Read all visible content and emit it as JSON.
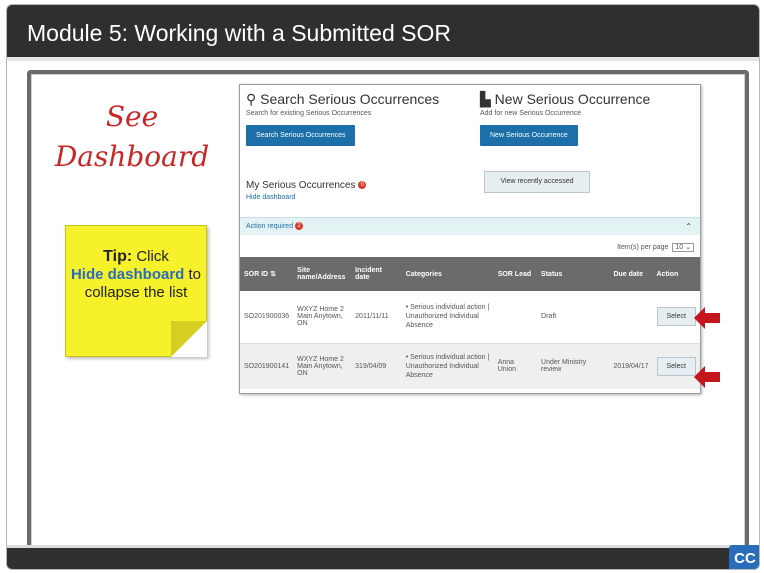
{
  "module_title": "Module 5:  Working with a Submitted SOR",
  "see_dashboard": {
    "line1": "See",
    "line2": "Dashboard"
  },
  "tip": {
    "label": "Tip:",
    "text1": "Click",
    "link": "Hide dashboard",
    "text2": "to collapse the list"
  },
  "panel": {
    "search": {
      "title": "Search Serious Occurrences",
      "subtitle": "Search for existing Serious Occurrences",
      "button": "Search Serious Occurrences",
      "icon": "search-icon"
    },
    "new": {
      "title": "New Serious Occurrence",
      "subtitle": "Add for new Serious Occurrence",
      "button": "New Serious Occurrence",
      "icon": "document-icon"
    },
    "my_so": {
      "title": "My Serious Occurrences",
      "badge": "0",
      "hide_link": "Hide dashboard"
    },
    "recent_button": "View recently accessed",
    "action_required": {
      "label": "Action required",
      "badge": "2"
    },
    "per_page": {
      "label": "Item(s) per page",
      "value": "10"
    },
    "columns": [
      "SOR ID",
      "Site name/Address",
      "Incident date",
      "Categories",
      "SOR Lead",
      "Status",
      "Due date",
      "Action"
    ],
    "rows": [
      {
        "sor_id": "SO201900036",
        "site": "WXYZ Home 2 Main Anytown, ON",
        "incident_date": "2011/11/11",
        "categories": "• Serious individual action | Unauthorized Individual Absence",
        "lead": "",
        "status": "Draft",
        "due": "",
        "action": "Select"
      },
      {
        "sor_id": "SO201900141",
        "site": "WXYZ Home 2 Main Anytown, ON",
        "incident_date": "319/04/09",
        "categories": "• Serious individual action | Unauthorized Individual Absence",
        "lead": "Anna Union",
        "status": "Under Ministry review",
        "due": "2019/04/17",
        "action": "Select"
      }
    ]
  },
  "cc_label": "CC",
  "colors": {
    "titlebar": "#2f2f2f",
    "accent_blue": "#1c6fa8",
    "arrow_red": "#c4161c",
    "tip_yellow": "#f7f12b",
    "see_red": "#c62828"
  }
}
